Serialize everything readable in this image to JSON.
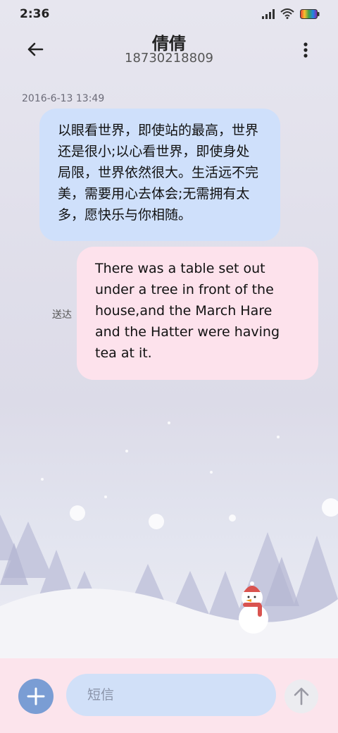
{
  "status_bar": {
    "time": "2:36"
  },
  "header": {
    "name": "倩倩",
    "phone": "18730218809"
  },
  "conversation": {
    "timestamp": "2016-6-13 13:49",
    "incoming": {
      "text": "以眼看世界，即使站的最高，世界还是很小;以心看世界，即使身处局限，世界依然很大。生活远不完美，需要用心去体会;无需拥有太多，愿快乐与你相随。"
    },
    "outgoing": {
      "text": "There was a table set out under a tree in front of the house,and the March Hare and the Hatter were having tea at it.",
      "status": "送达"
    }
  },
  "composer": {
    "placeholder": "短信"
  },
  "colors": {
    "incoming_bubble": "#cfe0fb",
    "outgoing_bubble": "#fde2ec",
    "composer_bg": "#fce4ec",
    "add_button": "#7a9dd4"
  },
  "icons": {
    "back": "back-arrow-icon",
    "more": "more-vertical-icon",
    "add": "plus-icon",
    "send": "send-arrow-icon"
  }
}
